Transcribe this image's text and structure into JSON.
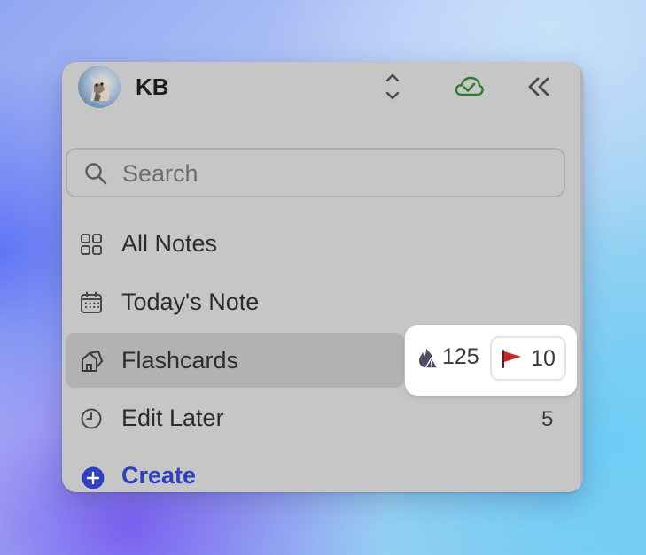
{
  "header": {
    "username": "KB",
    "avatar_icon": "cat-avatar",
    "switch_icon": "chevron-up-down-icon",
    "sync_icon": "cloud-check-icon",
    "collapse_icon": "double-chevron-left-icon"
  },
  "search": {
    "placeholder": "Search",
    "value": ""
  },
  "nav": {
    "all_notes": {
      "label": "All Notes",
      "icon": "grid-icon"
    },
    "todays_note": {
      "label": "Today's Note",
      "icon": "calendar-icon"
    },
    "flashcards": {
      "label": "Flashcards",
      "icon": "cards-icon",
      "streak_count": "125",
      "flag_count": "10"
    },
    "edit_later": {
      "label": "Edit Later",
      "icon": "clock-icon",
      "count": "5"
    }
  },
  "create": {
    "label": "Create",
    "icon": "plus-circle-icon"
  },
  "colors": {
    "panel": "#c6c6c7",
    "accent": "#2f3fc4",
    "sync_green": "#2e7d2e",
    "flag_red": "#c62828"
  }
}
